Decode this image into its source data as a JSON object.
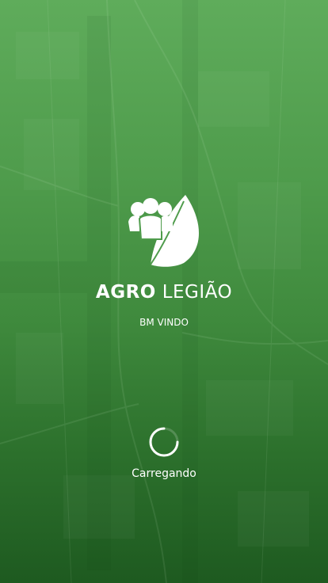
{
  "app": {
    "brand_bold": "AGRO",
    "brand_light": "LEGIÃO",
    "welcome": "BM VINDO"
  },
  "status": {
    "loading_label": "Carregando"
  },
  "icons": {
    "logo": "people-leaf-icon",
    "spinner": "spinner-icon"
  },
  "colors": {
    "background_top": "#5fac5b",
    "background_bottom": "#1e5a20",
    "foreground": "#ffffff"
  }
}
